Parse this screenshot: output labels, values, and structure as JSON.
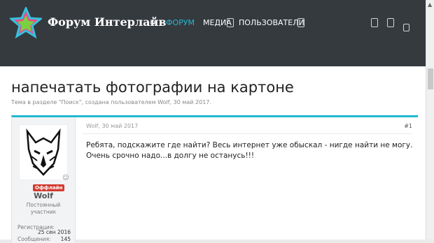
{
  "header": {
    "site_title": "Форум Интерлайв",
    "nav": [
      "ФОРУМ",
      "МЕДИА",
      "ПОЛЬЗОВАТЕЛИ"
    ],
    "colors": {
      "background": "#353a3f",
      "accent": "#23b8d3"
    }
  },
  "thread": {
    "title": "напечатать фотографии на картоне",
    "meta": "Тема в разделе \"Поиск\", создана пользователем Wolf, 30 май 2017."
  },
  "post": {
    "status_badge": "Оффлайн",
    "username": "Wolf",
    "user_title_line1": "Постоянный",
    "user_title_line2": "участник",
    "stats": [
      {
        "label": "Регистрация:",
        "value": "25 сен 2016"
      },
      {
        "label": "Сообщения:",
        "value": "145"
      }
    ],
    "date": "Wolf, 30 май 2017",
    "number": "#1",
    "text": "Ребята, подскажите где найти? Весь интернет уже обыскал - нигде найти не могу. Очень срочно надо...в долгу не останусь!!!"
  },
  "icons": [
    "star-logo-icon",
    "home-icon",
    "media-icon",
    "users-icon",
    "search-icon",
    "inbox-icon",
    "menu-icon",
    "mood-icon",
    "scroll-up-icon"
  ]
}
